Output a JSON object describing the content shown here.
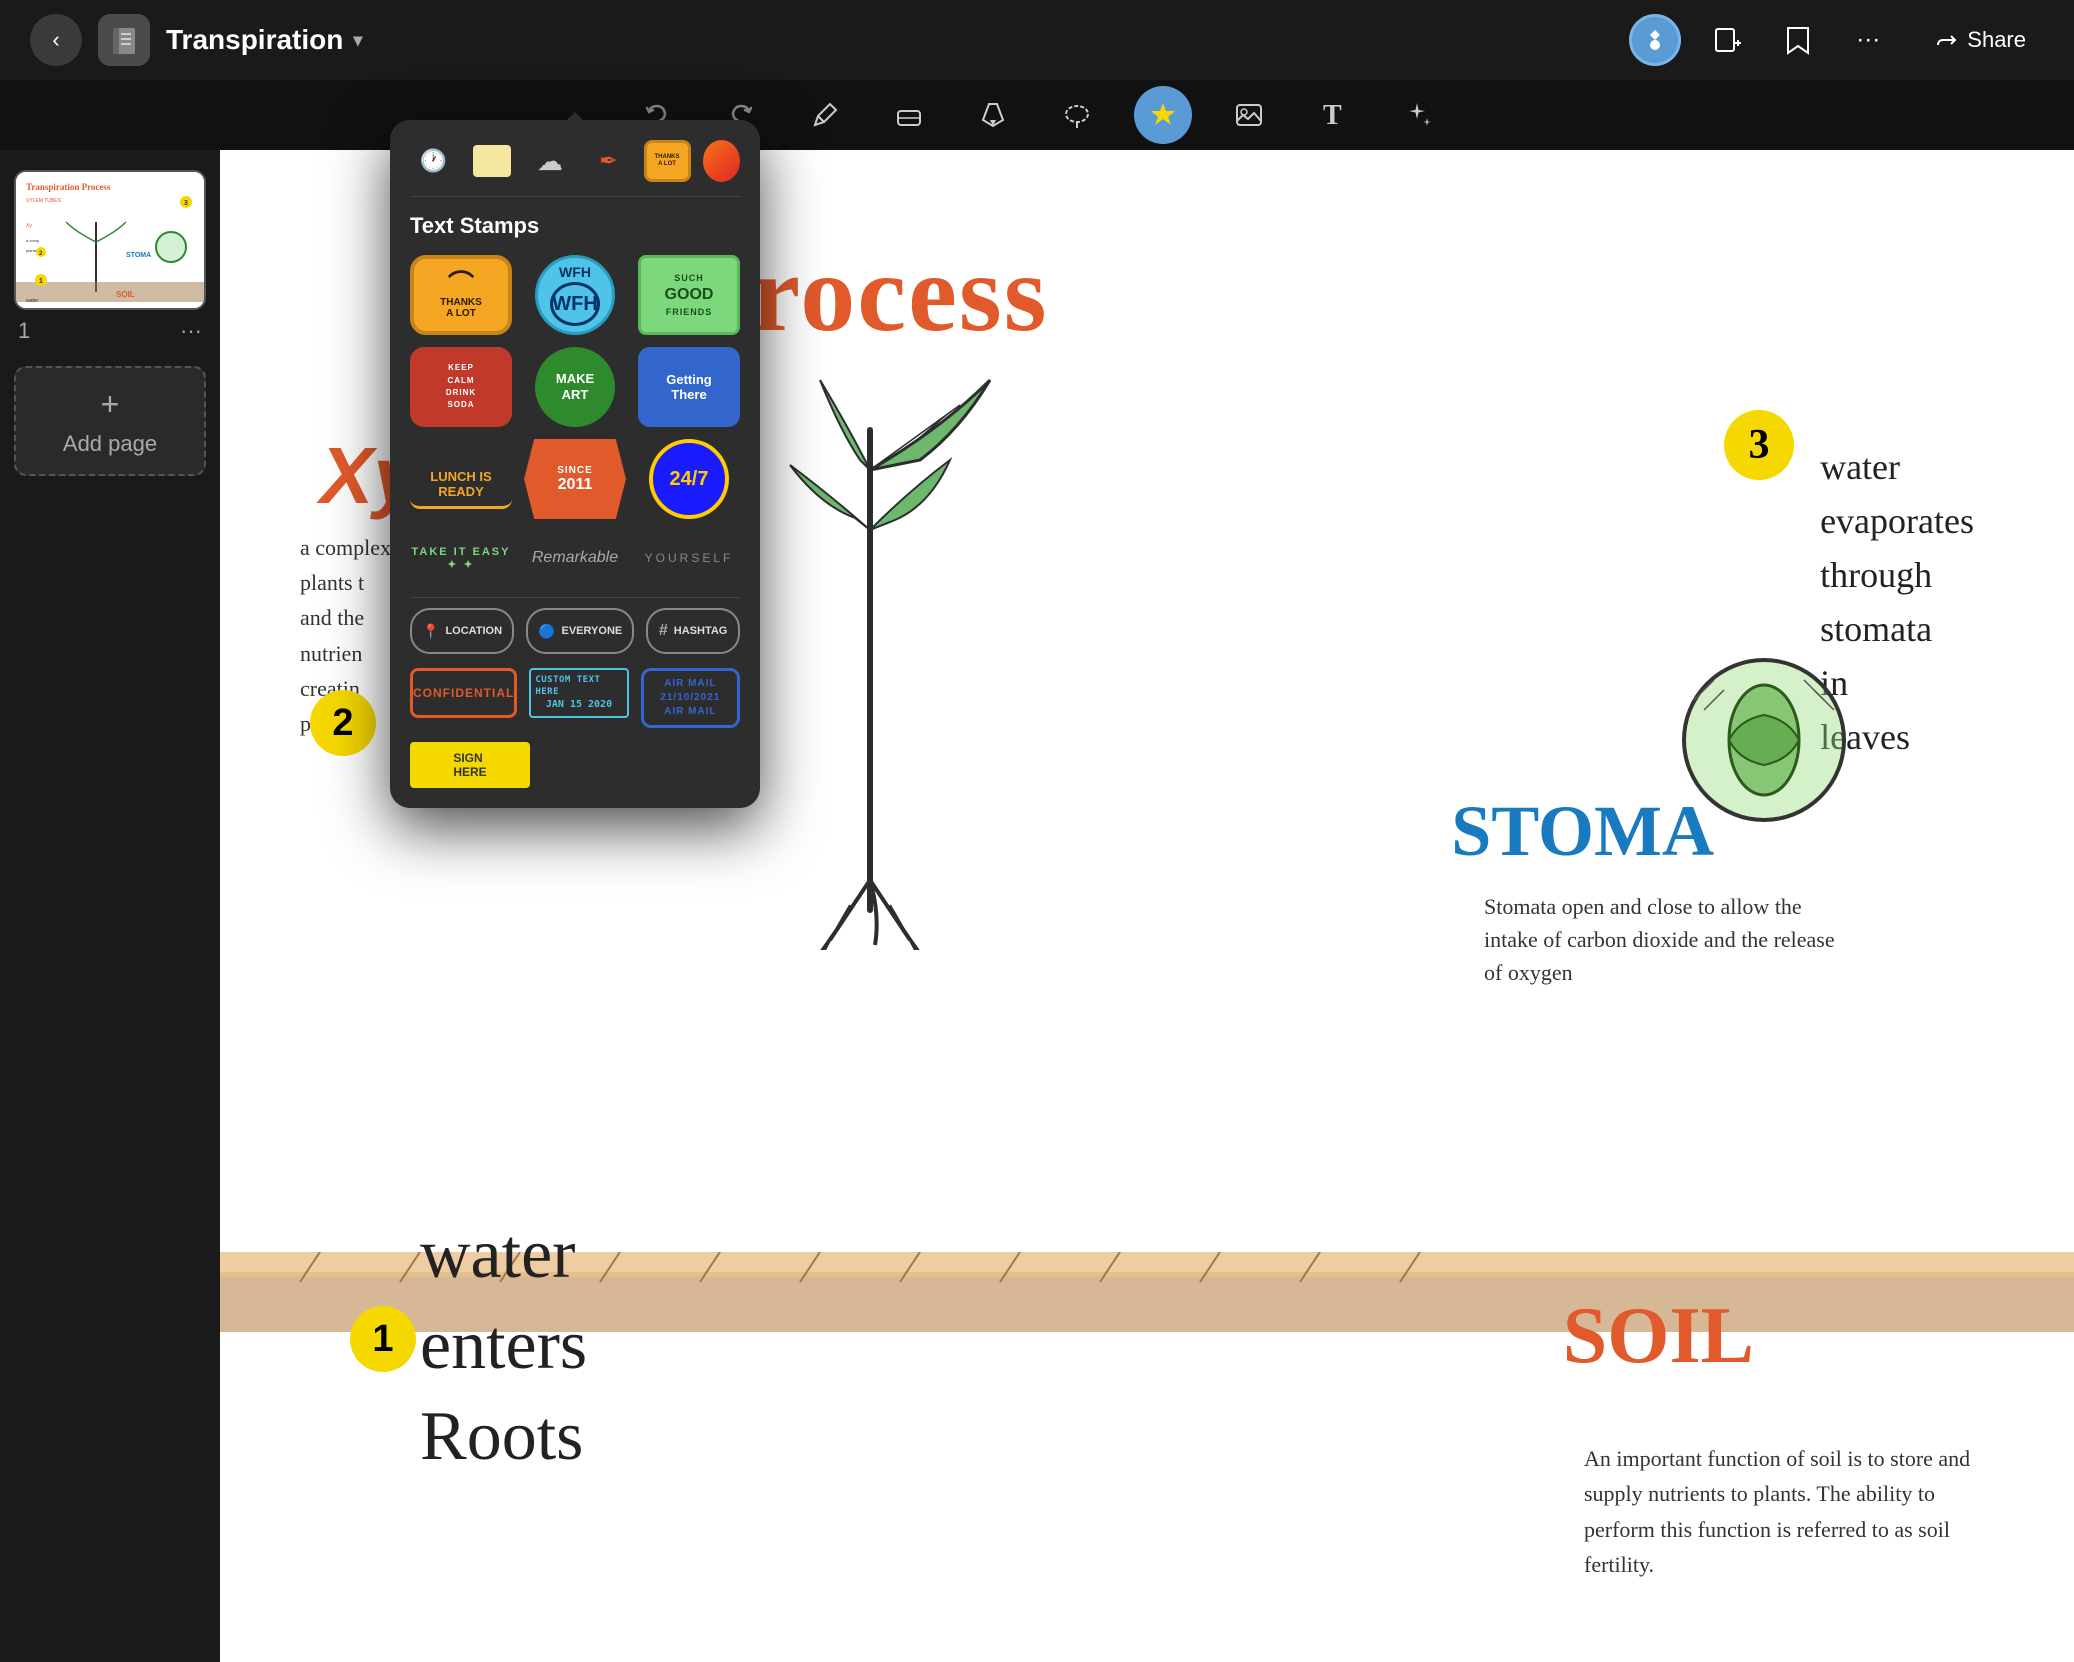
{
  "app": {
    "title": "Transpiration",
    "title_chevron": "▾"
  },
  "nav": {
    "back_label": "‹",
    "more_label": "···",
    "share_label": "Share",
    "share_icon": "↗"
  },
  "toolbar": {
    "undo": "↩",
    "redo": "↪",
    "pencil_icon": "✏",
    "eraser_icon": "◻",
    "pen_icon": "✒",
    "lasso_icon": "⊙",
    "shapes_icon": "⬟",
    "sticker_icon": "⭐",
    "image_icon": "⊞",
    "text_icon": "T",
    "magic_icon": "✦"
  },
  "sidebar": {
    "slide_number": "1",
    "more_icon": "···",
    "add_page_label": "Add page",
    "add_page_plus": "+"
  },
  "popup": {
    "section_label": "Text Stamps",
    "tabs": [
      {
        "id": "recent",
        "label": "🕐"
      },
      {
        "id": "square",
        "label": "□"
      },
      {
        "id": "cloud",
        "label": "☁"
      },
      {
        "id": "pen",
        "label": "✒"
      },
      {
        "id": "badge",
        "label": "THANKS\nA LOT"
      },
      {
        "id": "circle",
        "label": "●"
      }
    ],
    "stickers": [
      {
        "id": "thanks-lot",
        "label": "THANKS A LOT",
        "style": "thanks-lot"
      },
      {
        "id": "wfh",
        "label": "WFH",
        "style": "wfh"
      },
      {
        "id": "good-friends",
        "label": "SUCH GOOD FRIENDS",
        "style": "good-friends"
      },
      {
        "id": "keep-calm",
        "label": "KEEP CALM DRINK SODA",
        "style": "keep-calm"
      },
      {
        "id": "make-art",
        "label": "MAKE ART",
        "style": "make-art"
      },
      {
        "id": "getting-there",
        "label": "Getting There",
        "style": "getting-there"
      },
      {
        "id": "lunch-ready",
        "label": "LUNCH IS READY",
        "style": "lunch-ready"
      },
      {
        "id": "since-2011",
        "label": "SINCE 2011",
        "style": "since-2011"
      },
      {
        "id": "24-7",
        "label": "24/7",
        "style": "24-7"
      }
    ],
    "text_stickers": [
      {
        "id": "take-it-easy",
        "label": "TAKE IT EASY",
        "style": "take-it-easy"
      },
      {
        "id": "remarkable",
        "label": "Remarkable",
        "style": "remarkable"
      },
      {
        "id": "yourself",
        "label": "YOURSELF",
        "style": "yourself"
      }
    ],
    "tag_stickers": [
      {
        "id": "location",
        "label": "LOCATION",
        "icon": "📍"
      },
      {
        "id": "everyone",
        "label": "EVERYONE",
        "icon": "🔵"
      },
      {
        "id": "hashtag",
        "label": "HASHTAG",
        "icon": "#"
      }
    ],
    "stamp_stickers": [
      {
        "id": "confidential",
        "label": "CONFIDENTIAL"
      },
      {
        "id": "custom-date",
        "label": "CUSTOM TEXT HERE\nJAN 15 2020"
      },
      {
        "id": "air-mail",
        "label": "AIR MAIL\n21/10/2021\nAIR MAIL"
      }
    ],
    "bottom_stickers": [
      {
        "id": "sign-here",
        "label": "SIGN HERE"
      }
    ]
  },
  "canvas": {
    "title": "ion Process",
    "xylem": "Xy",
    "text1": "a complex\nplants t\nand the\nnutrien\ncreatin\nparendy",
    "num3": "3",
    "water_text": "water\nevaporates\nthrough\nstomata\nin\nleaves",
    "stoma_label": "STOMA",
    "stoma_text": "Stomata open and close to allow the intake of carbon dioxide and the release of oxygen",
    "soil_label": "SOIL",
    "soil_text": "An important function of soil is to store and supply nutrients to plants. The ability to perform this function is referred to as soil fertility.",
    "water_enters": "water\nenters\nRoots",
    "num1": "1",
    "num2": "2"
  }
}
